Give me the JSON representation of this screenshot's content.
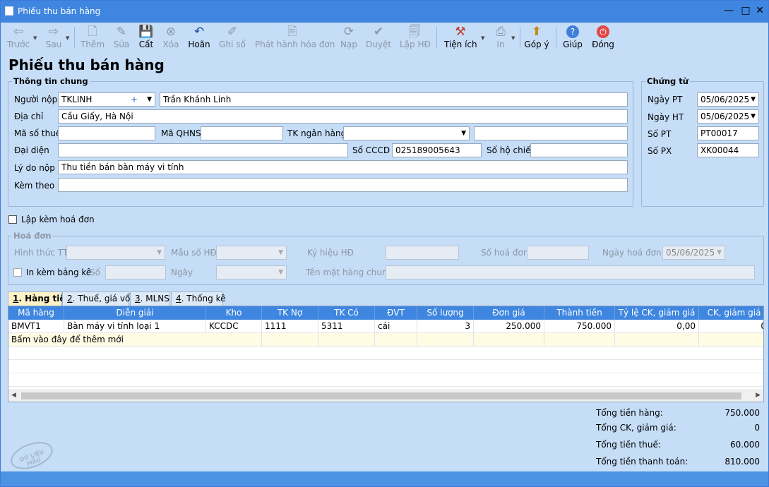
{
  "window": {
    "title": "Phiếu thu bán hàng",
    "min": "—",
    "max": "□",
    "close": "✕"
  },
  "toolbar": [
    {
      "id": "back",
      "label": "Trước",
      "icon": "⇦",
      "enabled": false
    },
    {
      "id": "next",
      "label": "Sau",
      "icon": "⇨",
      "enabled": false
    },
    {
      "id": "add",
      "label": "Thêm",
      "icon": "🗋",
      "enabled": false
    },
    {
      "id": "edit",
      "label": "Sửa",
      "icon": "✎",
      "enabled": false
    },
    {
      "id": "save",
      "label": "Cất",
      "icon": "💾",
      "enabled": true
    },
    {
      "id": "delete",
      "label": "Xóa",
      "icon": "⊗",
      "enabled": false
    },
    {
      "id": "undo",
      "label": "Hoãn",
      "icon": "↶",
      "enabled": true
    },
    {
      "id": "post",
      "label": "Ghi sổ",
      "icon": "✐",
      "enabled": false
    },
    {
      "id": "issue",
      "label": "Phát hành hóa đơn",
      "icon": "🖹",
      "enabled": false
    },
    {
      "id": "load",
      "label": "Nạp",
      "icon": "⟳",
      "enabled": false
    },
    {
      "id": "approve",
      "label": "Duyệt",
      "icon": "✔",
      "enabled": false
    },
    {
      "id": "create-invoice",
      "label": "Lập HĐ",
      "icon": "🗐",
      "enabled": false
    },
    {
      "id": "utilities",
      "label": "Tiện ích",
      "icon": "⚒",
      "enabled": true
    },
    {
      "id": "print",
      "label": "In",
      "icon": "⎙",
      "enabled": false
    },
    {
      "id": "feedback",
      "label": "Góp ý",
      "icon": "⬆",
      "enabled": true
    },
    {
      "id": "help",
      "label": "Giúp",
      "icon": "?",
      "enabled": true
    },
    {
      "id": "close",
      "label": "Đóng",
      "icon": "⏻",
      "enabled": true
    }
  ],
  "page_title": "Phiếu thu bán hàng",
  "general": {
    "group_label": "Thông tin chung",
    "payer_label": "Người nộp",
    "payer_code": "TKLINH",
    "payer_name": "Trần Khánh Linh",
    "address_label": "Địa chỉ",
    "address": "Cầu Giấy, Hà Nội",
    "tax_code_label": "Mã số thuế",
    "tax_code": "",
    "qhns_label": "Mã QHNS",
    "qhns": "",
    "bank_label": "TK ngân hàng",
    "bank": "",
    "bank_name": "",
    "rep_label": "Đại diện",
    "rep": "",
    "cccd_label": "Số CCCD",
    "cccd": "025189005643",
    "passport_label": "Số hộ chiếu",
    "passport": "",
    "reason_label": "Lý do nộp",
    "reason": "Thu tiền bán bàn máy vi tính",
    "attach_label": "Kèm theo",
    "attach": ""
  },
  "voucher": {
    "group_label": "Chứng từ",
    "date_pt_label": "Ngày PT",
    "date_pt": "05/06/2025",
    "date_ht_label": "Ngày HT",
    "date_ht": "05/06/2025",
    "so_pt_label": "Số PT",
    "so_pt": "PT00017",
    "so_px_label": "Số PX",
    "so_px": "XK00044"
  },
  "invoice_checkbox": "Lập kèm hoá đơn",
  "invoice": {
    "group_label": "Hoá đơn",
    "payment_method_label": "Hình thức TT",
    "template_label": "Mẫu số HĐ",
    "symbol_label": "Ký hiệu HĐ",
    "number_label": "Số hoá đơn",
    "date_label": "Ngày hoá đơn",
    "date": "05/06/2025",
    "print_list_label": "In kèm bảng kê",
    "so_label": "Số",
    "ngay_label": "Ngày",
    "common_name_label": "Tên mặt hàng chung"
  },
  "tabs": [
    {
      "key": "1",
      "label": ". Hàng tiền",
      "active": true
    },
    {
      "key": "2",
      "label": ". Thuế, giá vốn",
      "active": false
    },
    {
      "key": "3",
      "label": ". MLNS",
      "active": false
    },
    {
      "key": "4",
      "label": ". Thống kê",
      "active": false
    }
  ],
  "grid": {
    "columns": [
      "Mã hàng",
      "Diễn giải",
      "Kho",
      "TK Nợ",
      "TK Có",
      "ĐVT",
      "Số lượng",
      "Đơn giá",
      "Thành tiền",
      "Tỷ lệ CK, giảm giá",
      "CK, giảm giá"
    ],
    "rows": [
      [
        "BMVT1",
        "Bàn máy vi tính loại 1",
        "KCCDC",
        "1111",
        "5311",
        "cái",
        "3",
        "250.000",
        "750.000",
        "0,00",
        "0"
      ]
    ],
    "add_row_text": "Bấm vào đây để thêm mới"
  },
  "totals": [
    {
      "label": "Tổng tiền hàng:",
      "value": "750.000"
    },
    {
      "label": "Tổng CK, giảm giá:",
      "value": "0"
    },
    {
      "label": "Tổng tiền thuế:",
      "value": "60.000"
    },
    {
      "label": "Tổng tiền thanh toán:",
      "value": "810.000"
    }
  ],
  "stamp": "DỮ LIỆU MẪU",
  "colors": {
    "title_bar": "#3e86df",
    "body": "#c5ddf7",
    "grid_header": "#3e86df",
    "active_tab": "#fdf3c6"
  }
}
